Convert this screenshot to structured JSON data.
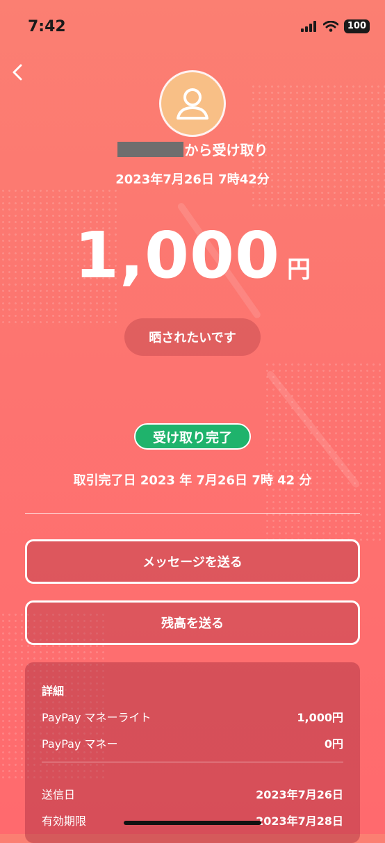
{
  "status_bar": {
    "time": "7:42",
    "battery": "100"
  },
  "header": {
    "sender_suffix": "から受け取り",
    "datetime": "2023年7月26日 7時42分"
  },
  "amount": {
    "value": "1,000",
    "unit": "円"
  },
  "memo": "晒されたいです",
  "status": {
    "badge": "受け取り完了",
    "badge_color": "#1fb36c",
    "completed_at": "取引完了日 2023 年 7月26日 7時 42 分"
  },
  "actions": {
    "send_message": "メッセージを送る",
    "send_balance": "残高を送る"
  },
  "details": {
    "title": "詳細",
    "rows": [
      {
        "label": "PayPay マネーライト",
        "value": "1,000円"
      },
      {
        "label": "PayPay マネー",
        "value": "0円"
      },
      {
        "label": "送信日",
        "value": "2023年7月26日"
      },
      {
        "label": "有効期限",
        "value": "2023年7月28日"
      }
    ]
  }
}
